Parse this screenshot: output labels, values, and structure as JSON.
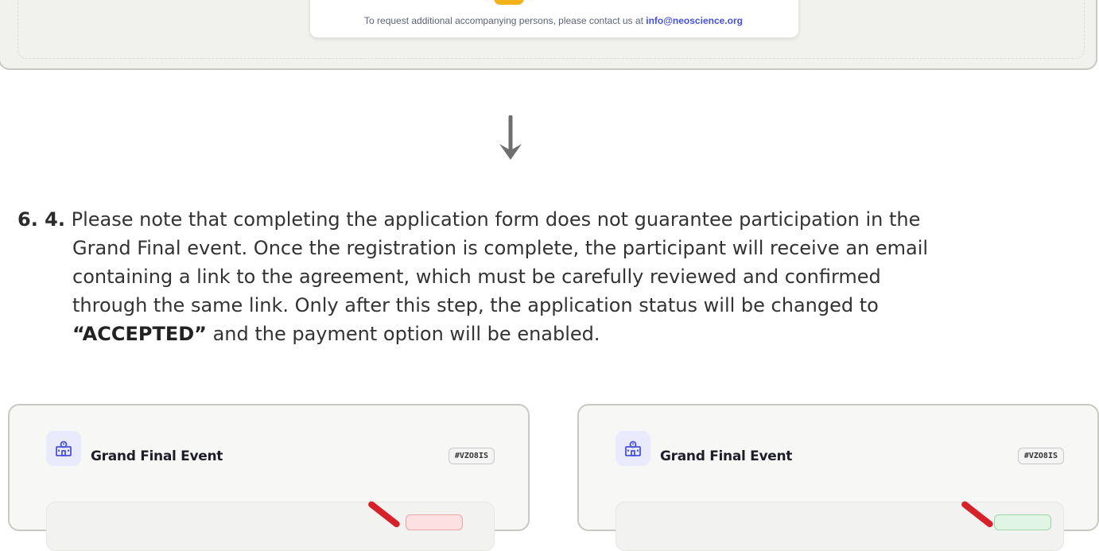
{
  "notice": {
    "text_before": "To request additional accompanying persons, please contact us at ",
    "email": "info@neoscience.org"
  },
  "section": {
    "number": "6. 4.",
    "line1": "Please note that completing the application form does not guarantee participation in the",
    "line2": "Grand Final event. Once the registration is complete, the participant will receive an email",
    "line3": "containing a link to the agreement, which must be carefully reviewed and confirmed",
    "line4": "through the same link. Only after this step, the application status will be changed to",
    "accepted": "“ACCEPTED”",
    "line5_rest": " and the payment option will be enabled."
  },
  "cards": [
    {
      "title": "Grand Final Event",
      "code": "#VZO8IS",
      "status_color": "#e9a5a8"
    },
    {
      "title": "Grand Final Event",
      "code": "#VZO8IS",
      "status_color": "#9fd6a8"
    }
  ],
  "icons": {
    "event": "school-building-icon",
    "arrow": "arrow-down-icon"
  }
}
